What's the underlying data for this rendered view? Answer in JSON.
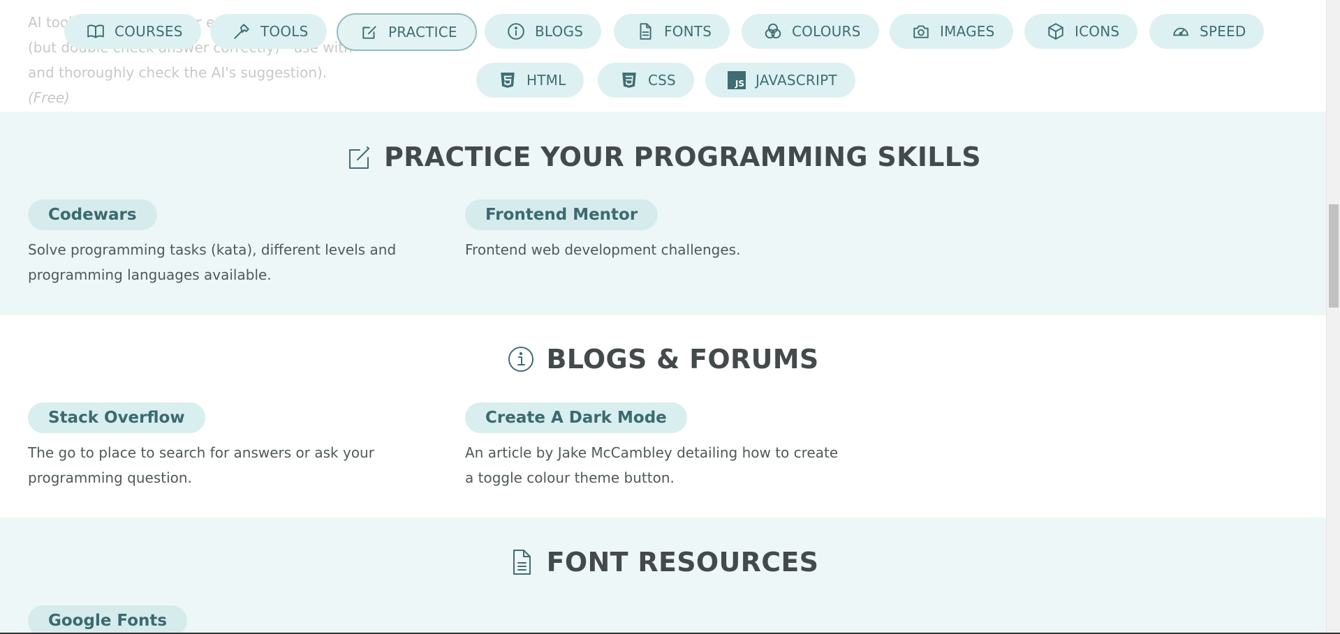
{
  "intro": {
    "line1": "AI tools can be useful for explaining code",
    "line2": "(but double check answer correctly) - use with",
    "line3": "and thoroughly check the AI's suggestion).",
    "free": "(Free)"
  },
  "nav": {
    "items": [
      {
        "label": "COURSES",
        "icon": "book-icon"
      },
      {
        "label": "TOOLS",
        "icon": "hammer-icon"
      },
      {
        "label": "PRACTICE",
        "icon": "edit-icon",
        "active": true
      },
      {
        "label": "BLOGS",
        "icon": "info-icon"
      },
      {
        "label": "FONTS",
        "icon": "document-icon"
      },
      {
        "label": "COLOURS",
        "icon": "color-circles-icon"
      },
      {
        "label": "IMAGES",
        "icon": "camera-icon"
      },
      {
        "label": "ICONS",
        "icon": "cube-icon"
      },
      {
        "label": "SPEED",
        "icon": "speedometer-icon"
      },
      {
        "label": "HTML",
        "icon": "html5-icon"
      },
      {
        "label": "CSS",
        "icon": "css3-icon"
      },
      {
        "label": "JAVASCRIPT",
        "icon": "js-icon"
      }
    ],
    "js_badge": "JS"
  },
  "sections": {
    "practice": {
      "title": "PRACTICE YOUR PROGRAMMING SKILLS",
      "icon": "edit-icon",
      "cards": [
        {
          "title": "Codewars",
          "desc": "Solve programming tasks (kata), different levels and programming languages available."
        },
        {
          "title": "Frontend Mentor",
          "desc": "Frontend web development challenges."
        }
      ]
    },
    "blogs": {
      "title": "BLOGS & FORUMS",
      "icon": "info-icon",
      "cards": [
        {
          "title": "Stack Overflow",
          "desc": "The go to place to search for answers or ask your programming question."
        },
        {
          "title": "Create A Dark Mode",
          "desc": "An article by Jake McCambley detailing how to create a toggle colour theme button."
        }
      ]
    },
    "fonts": {
      "title": "FONT RESOURCES",
      "icon": "document-icon",
      "cards": [
        {
          "title": "Google Fonts"
        }
      ]
    }
  },
  "colors": {
    "accent": "#3f6d73",
    "pill_bg": "#ddf1f2",
    "tint_bg": "#edf7f7"
  }
}
